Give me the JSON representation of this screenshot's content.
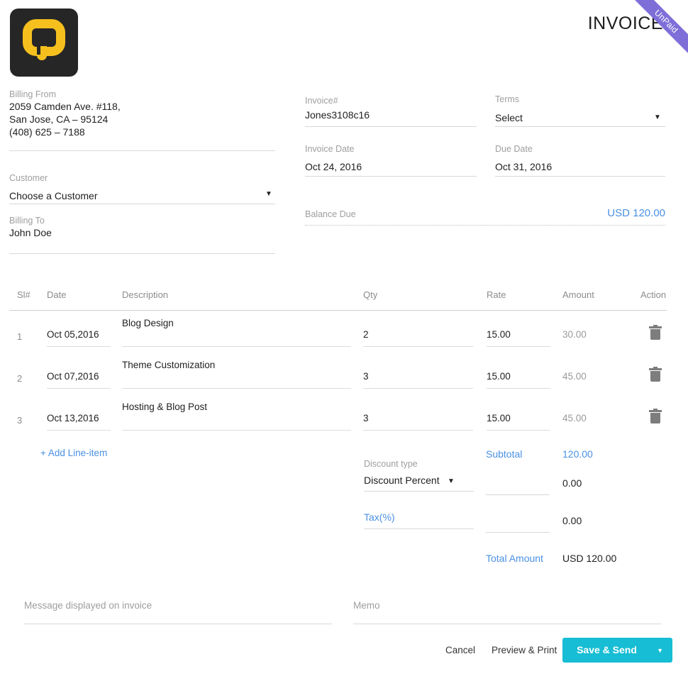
{
  "ribbon": {
    "text": "UnPaid",
    "color": "#7e6fd8"
  },
  "header": {
    "title": "INVOICE",
    "logo_name": "q-speech-bubble-logo"
  },
  "billing_from": {
    "label": "Billing From",
    "line1": "2059 Camden Ave. #118,",
    "line2": "San Jose, CA – 95124",
    "line3": "(408) 625 – 7188"
  },
  "customer": {
    "label": "Customer",
    "selected": "Choose a Customer"
  },
  "billing_to": {
    "label": "Billing To",
    "name": "John Doe"
  },
  "invoice_fields": {
    "invoice_number_label": "Invoice#",
    "invoice_number_value": "Jones3108c16",
    "terms_label": "Terms",
    "terms_value": "Select",
    "invoice_date_label": "Invoice Date",
    "invoice_date_value": "Oct 24, 2016",
    "due_date_label": "Due Date",
    "due_date_value": "Oct 31, 2016",
    "balance_due_label": "Balance Due",
    "balance_due_value": "USD 120.00"
  },
  "table": {
    "columns": [
      "Sl#",
      "Date",
      "Description",
      "Qty",
      "Rate",
      "Amount",
      "Action"
    ],
    "rows": [
      {
        "sl": "1",
        "date": "Oct 05,2016",
        "description": "Blog Design",
        "qty": "2",
        "rate": "15.00",
        "amount": "30.00"
      },
      {
        "sl": "2",
        "date": "Oct 07,2016",
        "description": "Theme Customization",
        "qty": "3",
        "rate": "15.00",
        "amount": "45.00"
      },
      {
        "sl": "3",
        "date": "Oct 13,2016",
        "description": "Hosting & Blog Post",
        "qty": "3",
        "rate": "15.00",
        "amount": "45.00"
      }
    ],
    "add_line_item": "+ Add Line-item"
  },
  "totals": {
    "discount_type_label": "Discount type",
    "discount_type_value": "Discount Percent",
    "discount_amount": "0.00",
    "tax_label": "Tax(%)",
    "tax_amount": "0.00",
    "subtotal_label": "Subtotal",
    "subtotal_value": "120.00",
    "total_label": "Total Amount",
    "total_value": "USD 120.00"
  },
  "footer": {
    "message_placeholder": "Message displayed on invoice",
    "message_value": "",
    "memo_placeholder": "Memo",
    "memo_value": "",
    "cancel_label": "Cancel",
    "preview_label": "Preview & Print",
    "save_label": "Save & Send"
  },
  "colors": {
    "accent_blue": "#4a90e2",
    "save_button": "#16bdd4",
    "ribbon_purple": "#7e6fd8",
    "logo_yellow": "#f5c01e",
    "logo_dark": "#262626"
  }
}
